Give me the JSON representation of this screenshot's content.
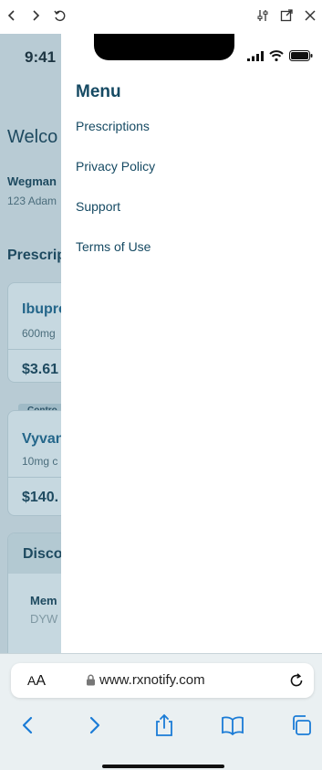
{
  "toolbar": {
    "icons": [
      "chevron-left-icon",
      "chevron-right-icon",
      "undo-icon",
      "sliders-icon",
      "open-external-icon",
      "close-icon"
    ]
  },
  "status_bar": {
    "time": "9:41"
  },
  "background_app": {
    "welcome": "Welco",
    "store_name": "Wegman",
    "store_address": "123 Adam",
    "prescriptions_heading": "Prescrip",
    "cards": [
      {
        "name": "Ibupro",
        "dose": "600mg",
        "price": "$3.61"
      },
      {
        "name": "Vyvan",
        "dose": "10mg c",
        "price": "$140."
      }
    ],
    "badge": "Contro",
    "discount_heading": "Disco",
    "member_label": "Mem",
    "member_value": "DYW"
  },
  "menu": {
    "title": "Menu",
    "items": [
      {
        "label": "Prescriptions"
      },
      {
        "label": "Privacy Policy"
      },
      {
        "label": "Support"
      },
      {
        "label": "Terms of Use"
      }
    ]
  },
  "browser": {
    "text_size_label_small": "A",
    "text_size_label_big": "A",
    "url": "www.rxnotify.com"
  },
  "colors": {
    "accent": "#164a63",
    "link_blue": "#1a7bd6",
    "overlay": "#b8cbd4"
  }
}
